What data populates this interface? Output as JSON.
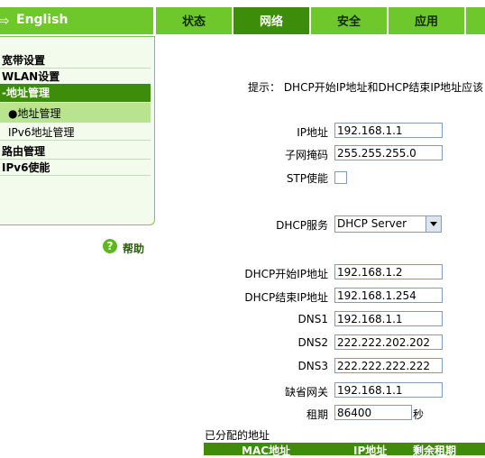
{
  "header": {
    "language": "English",
    "tabs": [
      {
        "label": "状态"
      },
      {
        "label": "网络"
      },
      {
        "label": "安全"
      },
      {
        "label": "应用"
      }
    ]
  },
  "sidebar": {
    "items": [
      {
        "label": "宽带设置"
      },
      {
        "label": "WLAN设置"
      },
      {
        "label": "-地址管理"
      },
      {
        "label": "●地址管理"
      },
      {
        "label": "IPv6地址管理"
      },
      {
        "label": "路由管理"
      },
      {
        "label": "IPv6使能"
      }
    ],
    "help_label": "帮助",
    "help_icon_text": "?"
  },
  "form": {
    "hint": "提示：  DHCP开始IP地址和DHCP结束IP地址应该",
    "ip_label": "IP地址",
    "ip_value": "192.168.1.1",
    "mask_label": "子网掩码",
    "mask_value": "255.255.255.0",
    "stp_label": "STP使能",
    "dhcp_service_label": "DHCP服务",
    "dhcp_service_value": "DHCP Server",
    "dhcp_start_label": "DHCP开始IP地址",
    "dhcp_start_value": "192.168.1.2",
    "dhcp_end_label": "DHCP结束IP地址",
    "dhcp_end_value": "192.168.1.254",
    "dns1_label": "DNS1",
    "dns1_value": "192.168.1.1",
    "dns2_label": "DNS2",
    "dns2_value": "222.222.202.202",
    "dns3_label": "DNS3",
    "dns3_value": "222.222.222.222",
    "gateway_label": "缺省网关",
    "gateway_value": "192.168.1.1",
    "lease_label": "租期",
    "lease_value": "86400",
    "lease_unit": "秒"
  },
  "assigned": {
    "title": "已分配的地址",
    "columns": [
      "MAC地址",
      "IP地址",
      "剩余租期"
    ]
  }
}
